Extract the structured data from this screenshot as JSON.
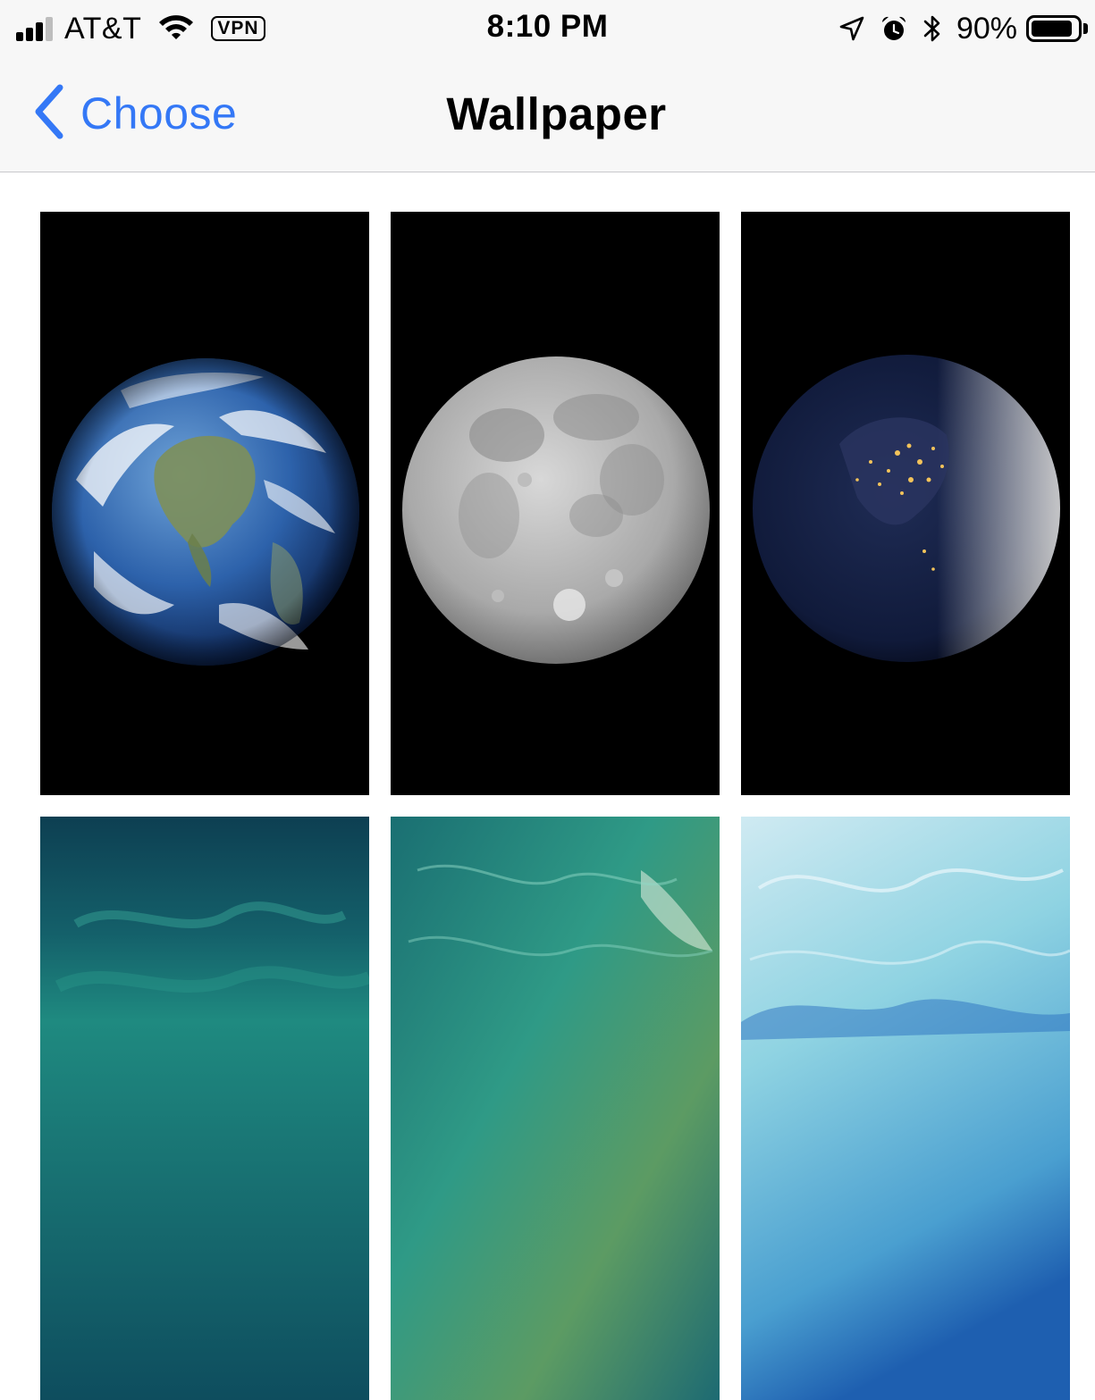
{
  "status_bar": {
    "carrier": "AT&T",
    "vpn": "VPN",
    "time": "8:10 PM",
    "battery_percent": "90%",
    "battery_level": 0.9,
    "signal_bars_filled": 3,
    "signal_bars_total": 4,
    "icons": [
      "signal-icon",
      "wifi-icon",
      "vpn-badge",
      "location-arrow-icon",
      "alarm-icon",
      "bluetooth-icon",
      "battery-icon"
    ]
  },
  "nav": {
    "back_label": "Choose",
    "title": "Wallpaper",
    "accent": "#3478f6"
  },
  "wallpapers": [
    {
      "name": "earth"
    },
    {
      "name": "moon"
    },
    {
      "name": "earth-night"
    },
    {
      "name": "ocean-teal"
    },
    {
      "name": "ocean-green"
    },
    {
      "name": "ocean-light-blue"
    }
  ]
}
